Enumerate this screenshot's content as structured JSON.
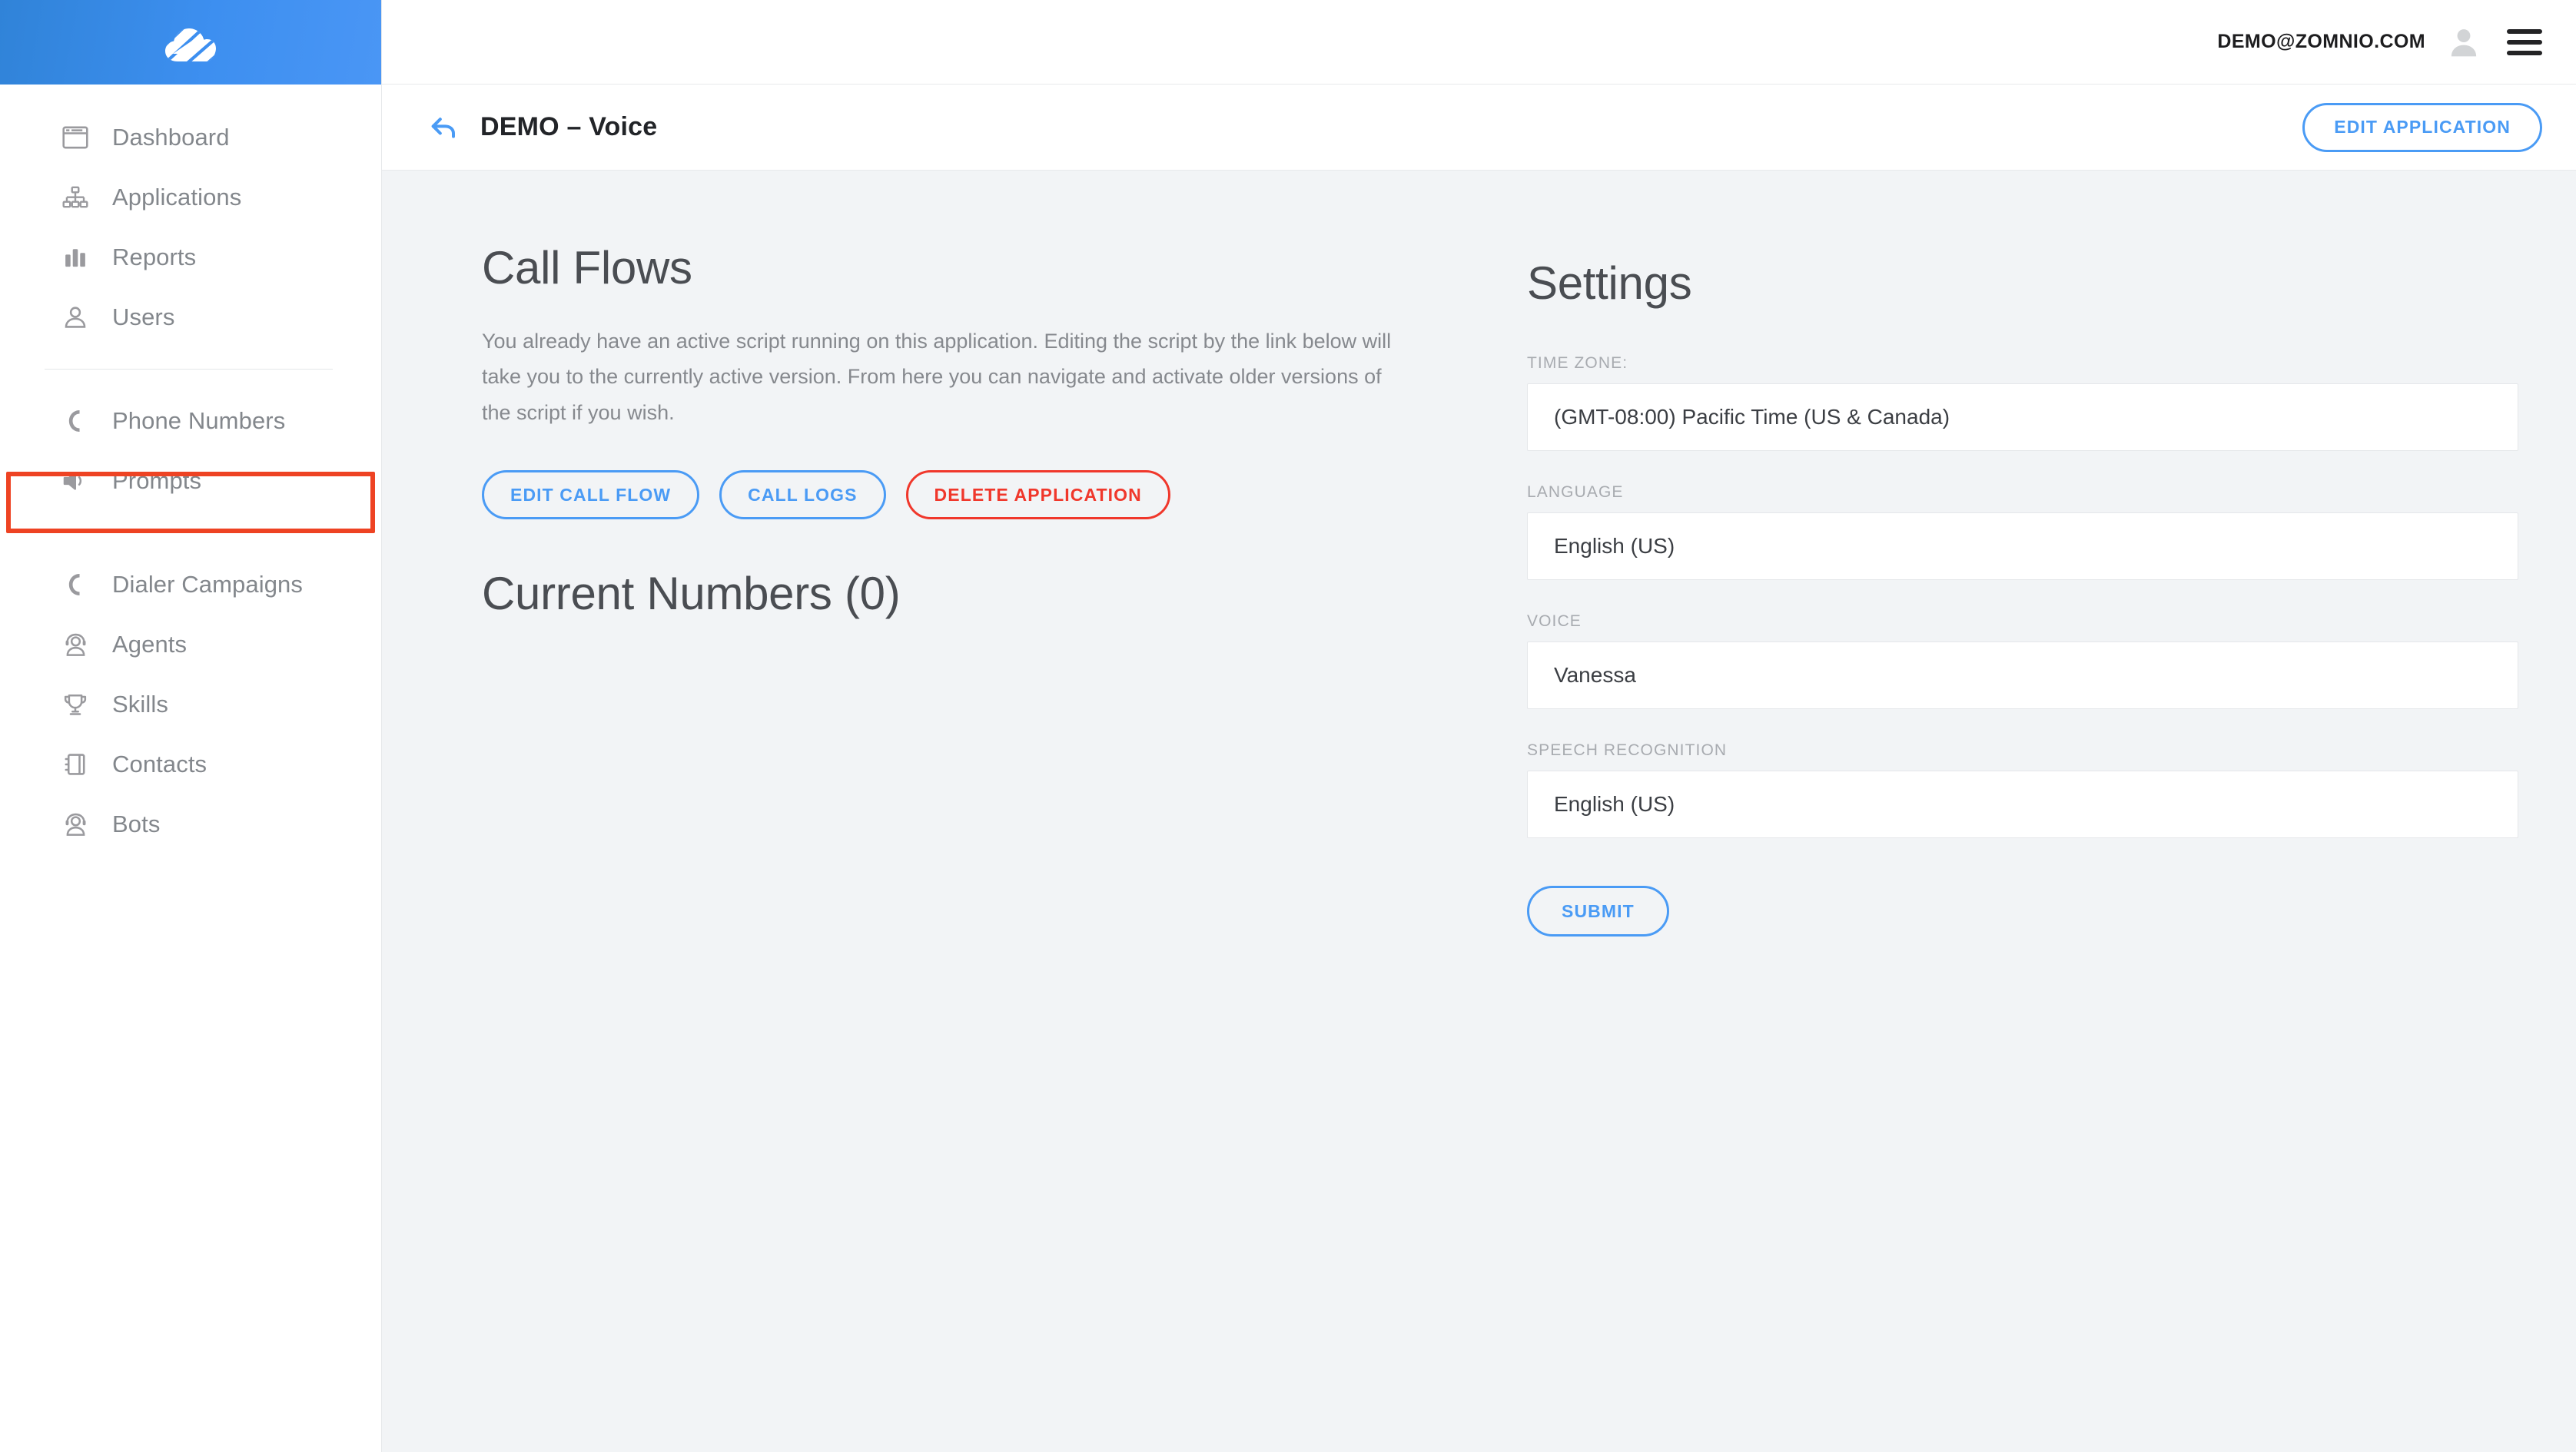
{
  "brand": {
    "logo_icon": "cloud-swoosh-logo",
    "accent_blue": "#4a9bf5",
    "accent_red": "#f0372b",
    "highlight_red": "#ee4323",
    "sidebar_bg": "#ffffff",
    "content_bg": "#f2f4f6"
  },
  "topbar": {
    "user_email": "DEMO@ZOMNIO.COM",
    "avatar_icon": "user-avatar-icon",
    "menu_icon": "hamburger-menu-icon"
  },
  "sidebar": {
    "groups": [
      {
        "items": [
          {
            "label": "Dashboard",
            "icon": "browser-window-icon"
          },
          {
            "label": "Applications",
            "icon": "org-chart-icon"
          },
          {
            "label": "Reports",
            "icon": "bar-chart-icon"
          },
          {
            "label": "Users",
            "icon": "person-icon"
          }
        ]
      },
      {
        "items": [
          {
            "label": "Phone Numbers",
            "icon": "phone-icon",
            "highlighted": true
          },
          {
            "label": "Prompts",
            "icon": "speaker-icon"
          }
        ]
      },
      {
        "items": [
          {
            "label": "Dialer Campaigns",
            "icon": "phone-icon"
          },
          {
            "label": "Agents",
            "icon": "headset-person-icon"
          },
          {
            "label": "Skills",
            "icon": "trophy-icon"
          },
          {
            "label": "Contacts",
            "icon": "address-book-icon"
          },
          {
            "label": "Bots",
            "icon": "headset-person-icon"
          }
        ]
      }
    ]
  },
  "pagehead": {
    "back_icon": "back-arrow-icon",
    "title": "DEMO – Voice",
    "edit_application_label": "EDIT APPLICATION"
  },
  "call_flows": {
    "heading": "Call Flows",
    "description": "You already have an active script running on this application. Editing the script by the link below will take you to the currently active version. From here you can navigate and activate older versions of the script if you wish.",
    "buttons": {
      "edit_call_flow": "EDIT CALL FLOW",
      "call_logs": "CALL LOGS",
      "delete_application": "DELETE APPLICATION"
    },
    "current_numbers_heading": "Current Numbers (0)"
  },
  "settings": {
    "heading": "Settings",
    "fields": [
      {
        "label": "TIME ZONE:",
        "value": "(GMT-08:00) Pacific Time (US & Canada)"
      },
      {
        "label": "LANGUAGE",
        "value": "English (US)"
      },
      {
        "label": "VOICE",
        "value": "Vanessa"
      },
      {
        "label": "SPEECH RECOGNITION",
        "value": "English (US)"
      }
    ],
    "submit_label": "SUBMIT"
  }
}
